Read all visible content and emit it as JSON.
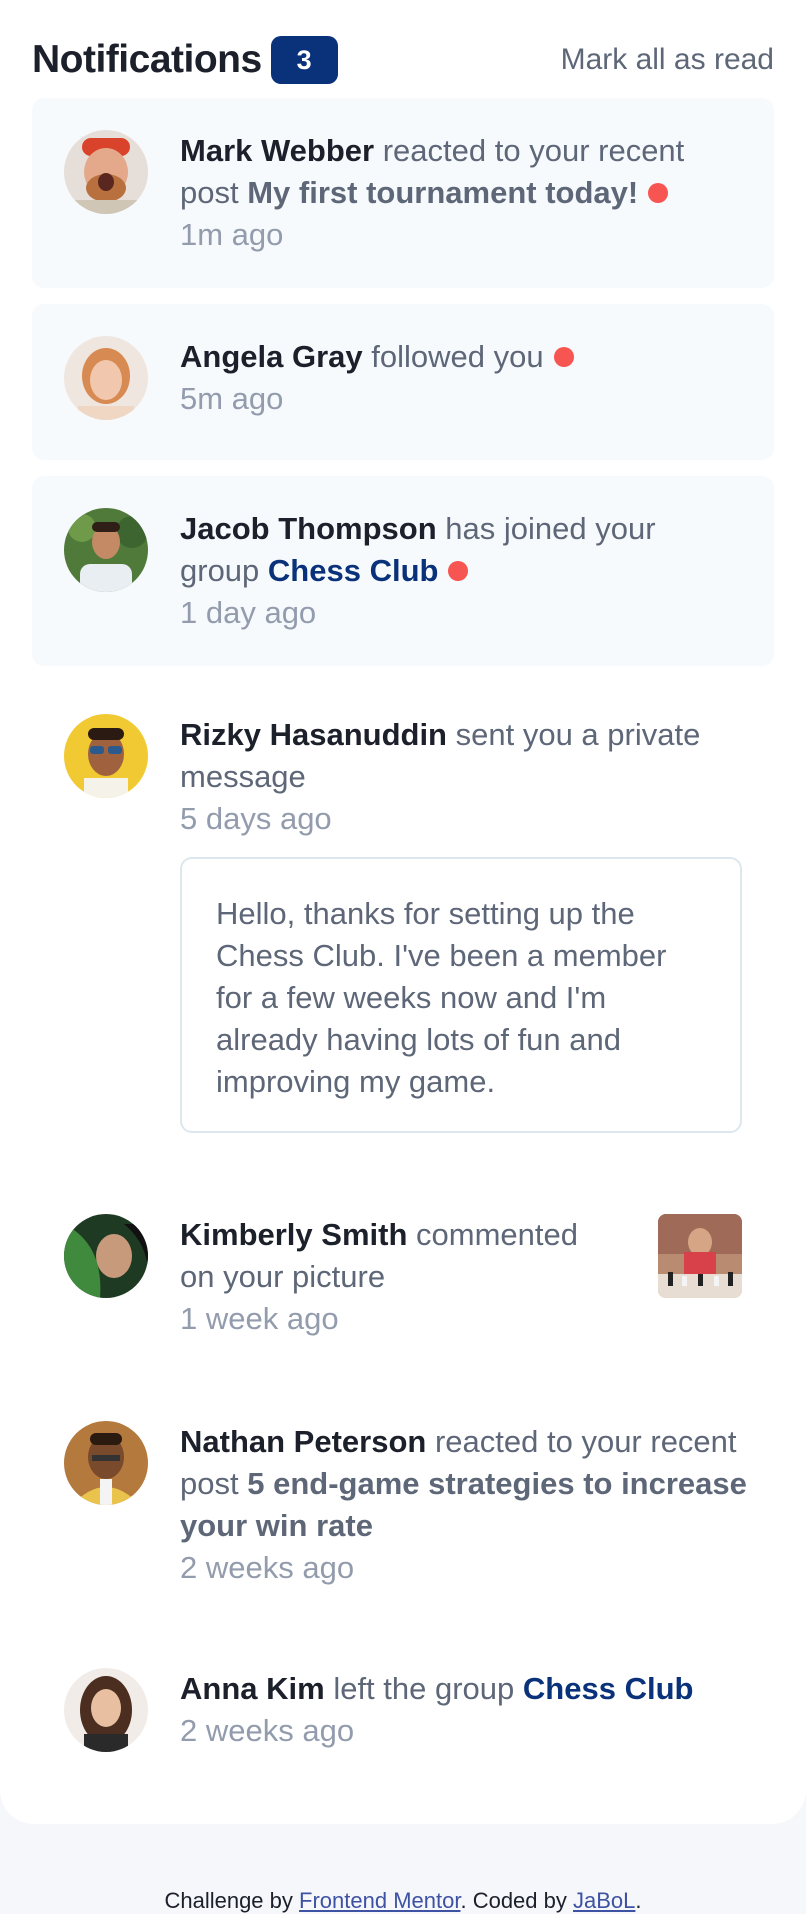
{
  "header": {
    "title": "Notifications",
    "unread_count": "3",
    "mark_all_label": "Mark all as read"
  },
  "notifications": [
    {
      "name": "Mark Webber",
      "action": "reacted to your recent post",
      "post": "My first tournament today!",
      "time": "1m ago",
      "unread": true
    },
    {
      "name": "Angela Gray",
      "action": "followed you",
      "time": "5m ago",
      "unread": true
    },
    {
      "name": "Jacob Thompson",
      "action": "has joined your group",
      "group": "Chess Club",
      "time": "1 day ago",
      "unread": true
    },
    {
      "name": "Rizky Hasanuddin",
      "action": "sent you a private message",
      "time": "5 days ago",
      "message": "Hello, thanks for setting up the Chess Club. I've been a member for a few weeks now and I'm already having lots of fun and improving my game.",
      "unread": false
    },
    {
      "name": "Kimberly Smith",
      "action": "commented on your picture",
      "time": "1 week ago",
      "unread": false
    },
    {
      "name": "Nathan Peterson",
      "action": "reacted to your recent post",
      "post": "5 end-game strategies to increase your win rate",
      "time": "2 weeks ago",
      "unread": false
    },
    {
      "name": "Anna Kim",
      "action": "left the group",
      "group": "Chess Club",
      "time": "2 weeks ago",
      "unread": false
    }
  ],
  "footer": {
    "prefix": "Challenge by",
    "link1": "Frontend Mentor",
    "middle": ". Coded by",
    "link2": "JaBoL",
    "suffix": "."
  },
  "colors": {
    "accent": "#0a327b",
    "unread_dot": "#f65552",
    "unread_bg": "#f7fafd"
  }
}
